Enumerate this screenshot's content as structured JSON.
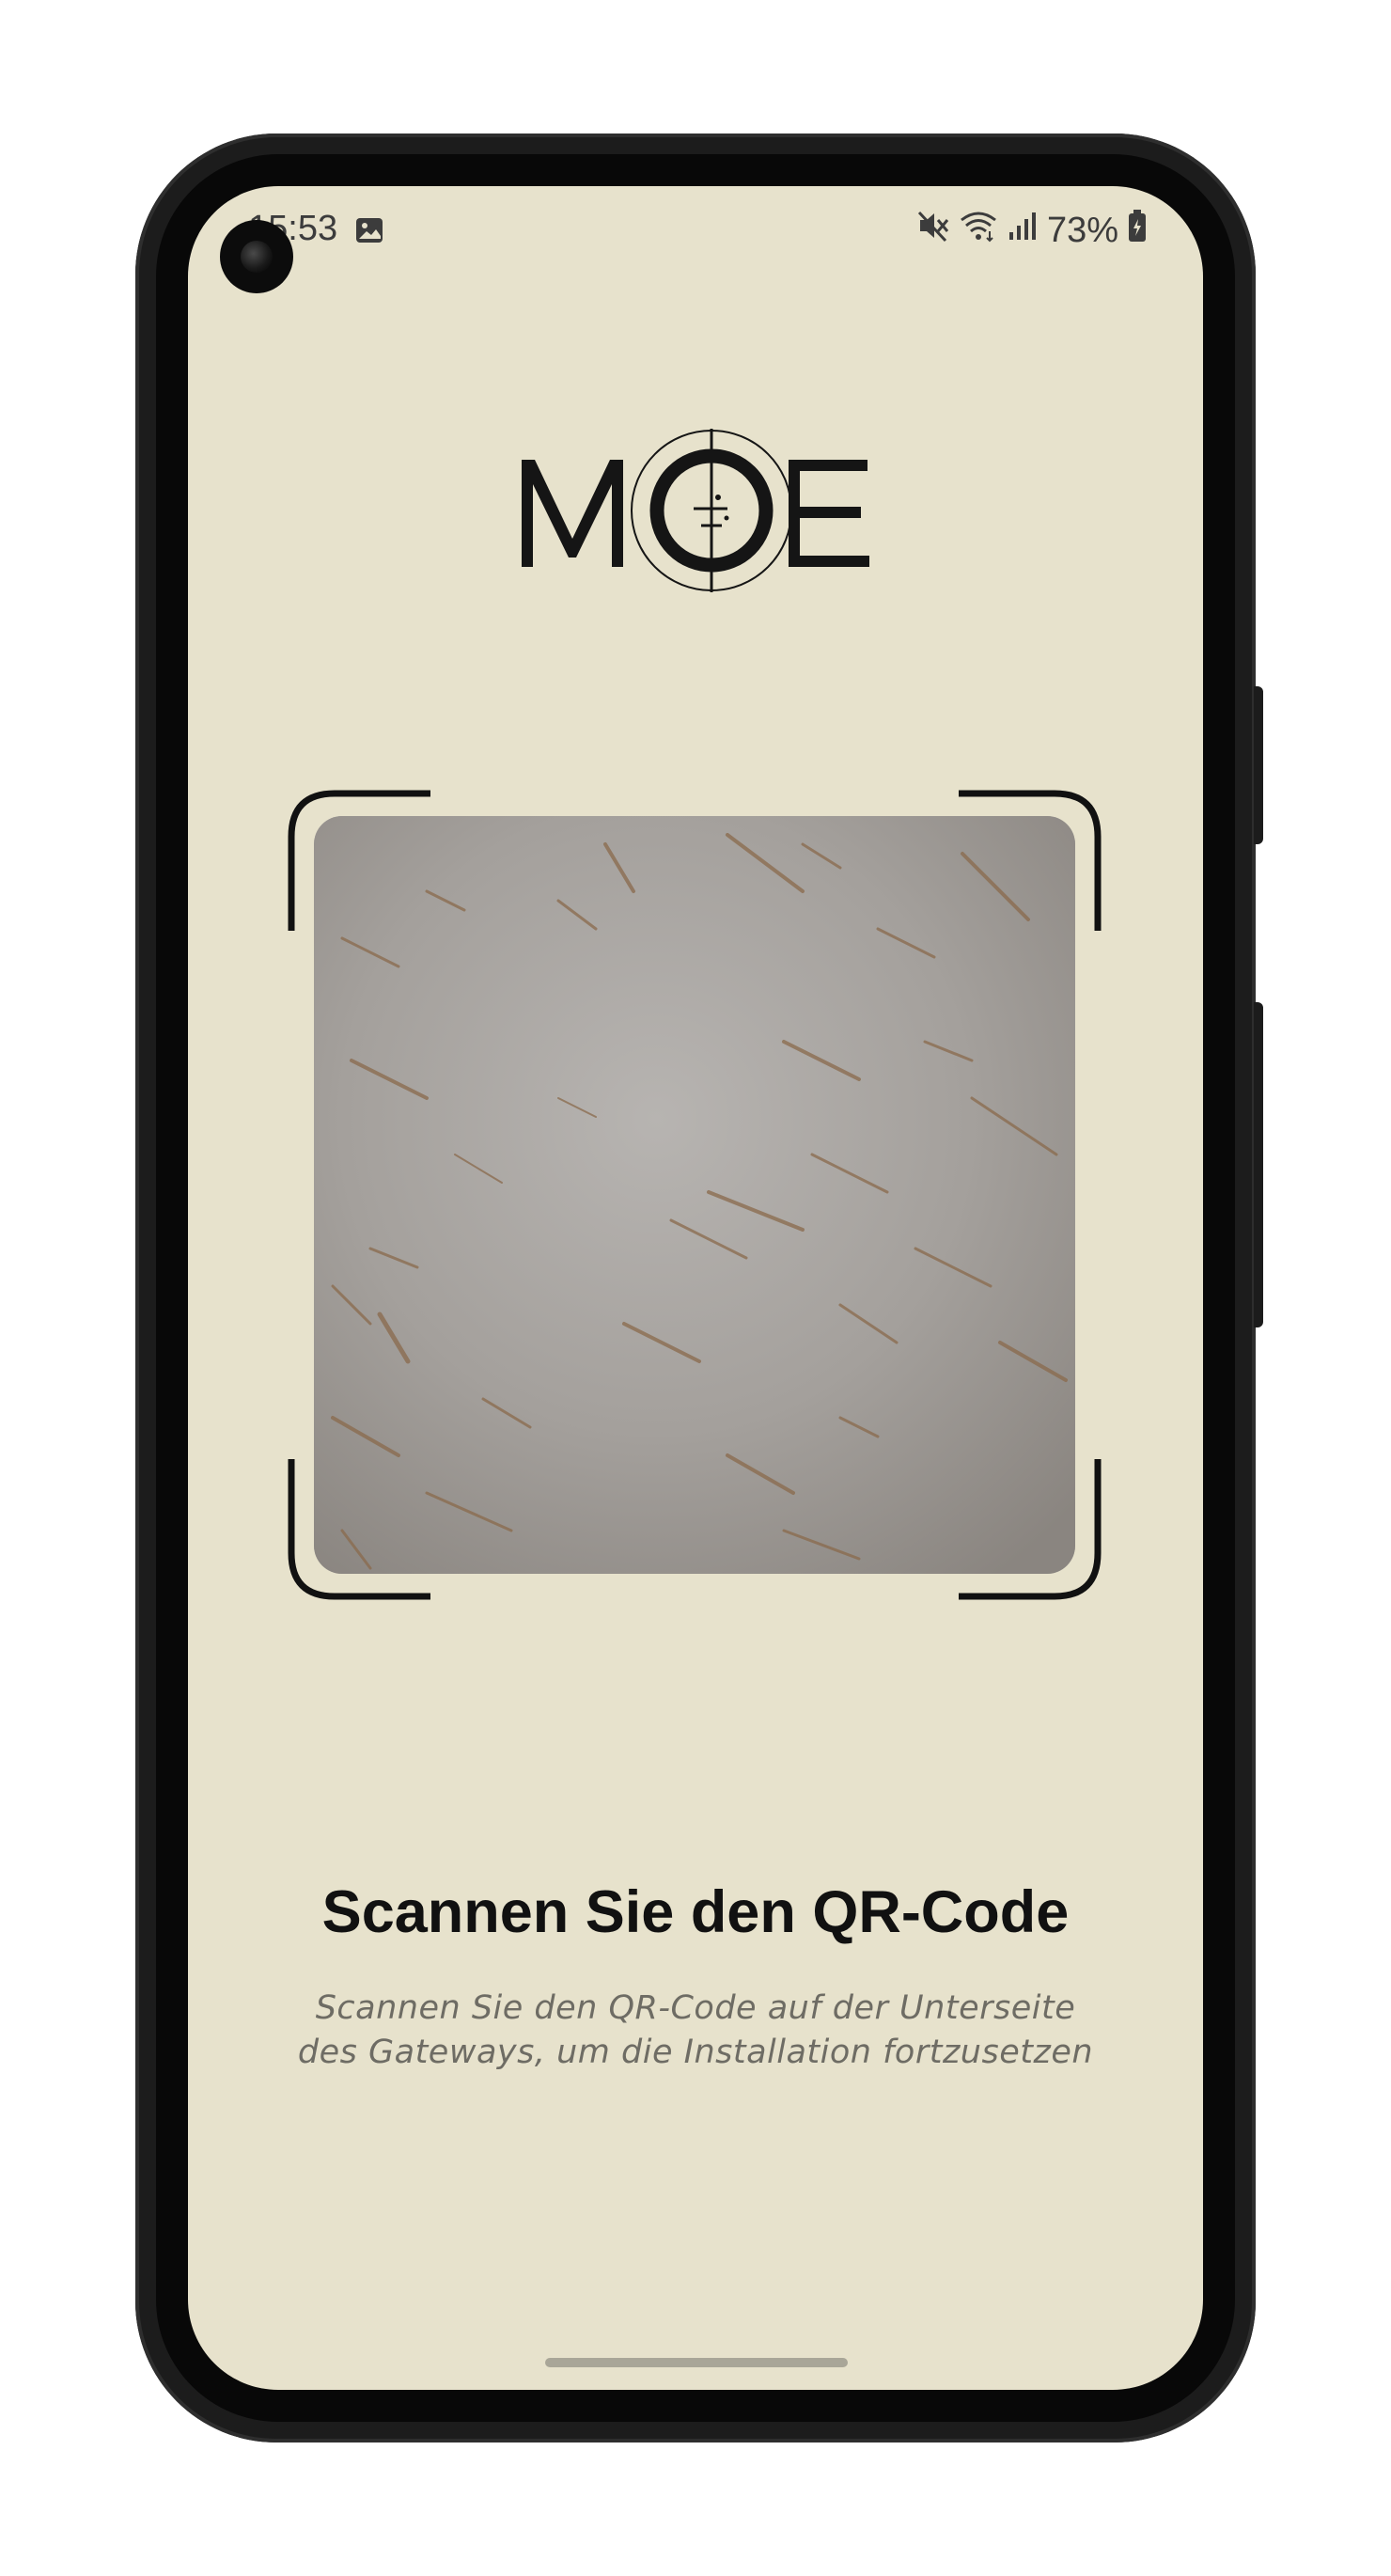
{
  "status_bar": {
    "time": "15:53",
    "battery": "73%",
    "icons": [
      "gallery-icon",
      "mute-icon",
      "wifi-icon",
      "signal-icon",
      "battery-icon"
    ]
  },
  "logo": {
    "text": "MOE"
  },
  "scanner": {
    "title": "Scannen Sie den QR-Code",
    "subtitle": "Scannen Sie den QR-Code auf der Unterseite des Gateways, um die Installation fortzusetzen"
  },
  "colors": {
    "background": "#e7e2cc",
    "title": "#111111",
    "subtitle": "#6e6c64",
    "frame": "#111111"
  }
}
